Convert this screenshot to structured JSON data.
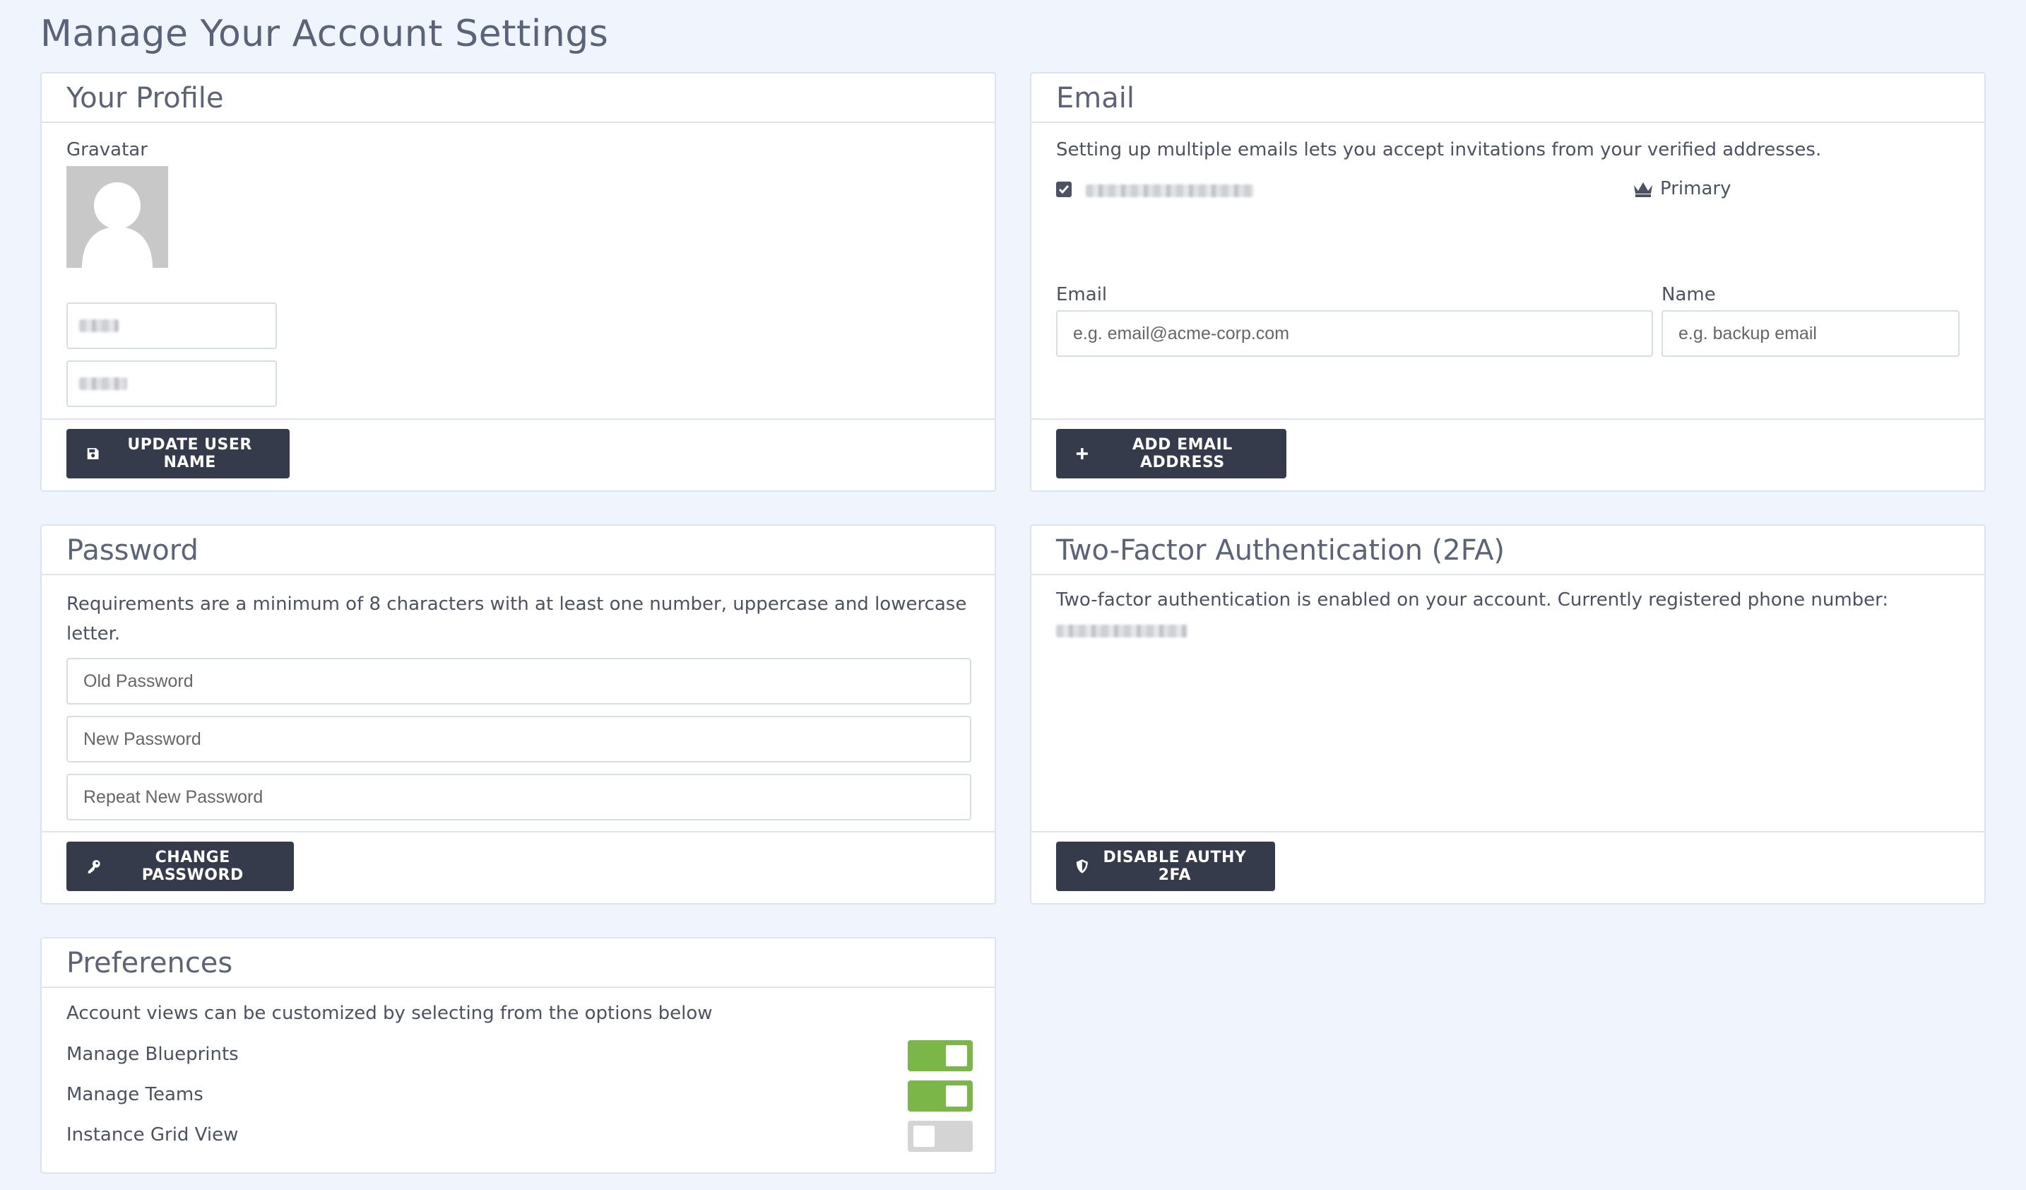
{
  "page": {
    "title": "Manage Your Account Settings"
  },
  "profile": {
    "title": "Your Profile",
    "gravatar_label": "Gravatar",
    "first_name_value": "",
    "last_name_value": "",
    "button_label": "UPDATE USER NAME",
    "button_icon": "save-icon"
  },
  "email": {
    "title": "Email",
    "description": "Setting up multiple emails lets you accept invitations from your verified addresses.",
    "primary_label": "Primary",
    "primary_icon": "crown-icon",
    "email_label": "Email",
    "email_placeholder": "e.g. email@acme-corp.com",
    "name_label": "Name",
    "name_placeholder": "e.g. backup email",
    "button_label": "ADD EMAIL ADDRESS",
    "button_icon": "plus-icon"
  },
  "password": {
    "title": "Password",
    "description": "Requirements are a minimum of 8 characters with at least one number, uppercase and lowercase letter.",
    "old_placeholder": "Old Password",
    "new_placeholder": "New Password",
    "repeat_placeholder": "Repeat New Password",
    "button_label": "CHANGE PASSWORD",
    "button_icon": "key-icon"
  },
  "twofa": {
    "title": "Two-Factor Authentication (2FA)",
    "description": "Two-factor authentication is enabled on your account. Currently registered phone number:",
    "button_label": "DISABLE AUTHY 2FA",
    "button_icon": "shield-icon"
  },
  "preferences": {
    "title": "Preferences",
    "description": "Account views can be customized by selecting from the options below",
    "items": [
      {
        "label": "Manage Blueprints",
        "enabled": true
      },
      {
        "label": "Manage Teams",
        "enabled": true
      },
      {
        "label": "Instance Grid View",
        "enabled": false
      }
    ]
  },
  "colors": {
    "background": "#f0f4fc",
    "button": "#353b4b",
    "toggle_on": "#7ab648",
    "toggle_off": "#d4d4d4"
  }
}
